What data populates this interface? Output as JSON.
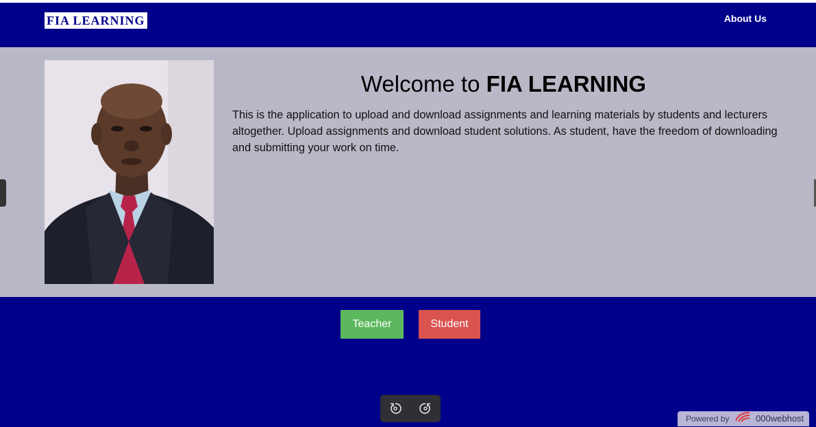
{
  "navbar": {
    "logo_text": "FIA LEARNING",
    "about_label": "About Us",
    "background": "#00008b"
  },
  "hero": {
    "title_prefix": "Welcome to ",
    "title_brand": "FIA LEARNING",
    "description": "This is the application to upload and download assignments and learning materials by students and lecturers altogether. Upload assignments and download student solutions. As student, have the freedom of downloading and submitting your work on time.",
    "background": "#b9b8c6"
  },
  "actions": {
    "teacher_label": "Teacher",
    "student_label": "Student",
    "teacher_color": "#5cb85c",
    "student_color": "#d9534f"
  },
  "toolbar": {
    "rotate_left_icon": "rotate-left-icon",
    "rotate_right_icon": "rotate-right-icon"
  },
  "footer": {
    "powered_prefix": "Powered by",
    "powered_brand": "000webhost"
  }
}
